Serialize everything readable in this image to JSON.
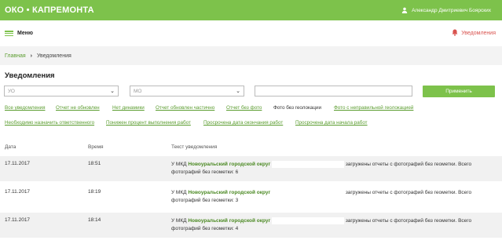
{
  "header": {
    "brand": "ОКО • КАПРЕМОНТА",
    "user_name": "Александр Дмитриевич Боярских"
  },
  "menubar": {
    "menu_label": "Меню",
    "notifications_label": "Уведомления"
  },
  "breadcrumb": {
    "home": "Главная",
    "current": "Уведомления"
  },
  "page": {
    "title": "Уведомления"
  },
  "filters": {
    "uo_placeholder": "УО",
    "mo_placeholder": "МО",
    "search_value": "",
    "apply_label": "Применить",
    "links_row1": [
      "Все уведомления",
      "Отчет не обновлен",
      "Нет динамики",
      "Отчет обновлен частично",
      "Отчет без фото",
      "Фото без геолокации",
      "Фото с неправильной геолокацией"
    ],
    "links_row2": [
      "Необходимо назначить ответственного",
      "Понижен процент выполнения работ",
      "Просрочена дата окончания работ",
      "Просрочена дата начала работ"
    ],
    "active": "Фото без геолокации"
  },
  "table": {
    "columns": [
      "Дата",
      "Время",
      "Текст уведомления"
    ],
    "rows": [
      {
        "date": "17.11.2017",
        "time": "18:51",
        "prefix": "У МКД",
        "org": "Новоуральский городской округ",
        "suffix": "загружены отчеты с фотографий без геометки. Всего",
        "line2": "фотографий без геометки: 6"
      },
      {
        "date": "17.11.2017",
        "time": "18:19",
        "prefix": "У МКД",
        "org": "Новоуральский городской округ",
        "suffix": "загружены отчеты с фотографий без геометки. Всего",
        "line2": "фотографий без геометки: 3"
      },
      {
        "date": "17.11.2017",
        "time": "18:14",
        "prefix": "У МКД",
        "org": "Новоуральский городской округ",
        "suffix": "загружены отчеты с фотографий без геометки. Всего",
        "line2": "фотографий без геометки: 4"
      }
    ]
  },
  "colors": {
    "brand_green": "#7dc24b",
    "link_green": "#5a9c2e",
    "alert_red": "#d9534f",
    "row_alt": "#f1f1f1"
  }
}
